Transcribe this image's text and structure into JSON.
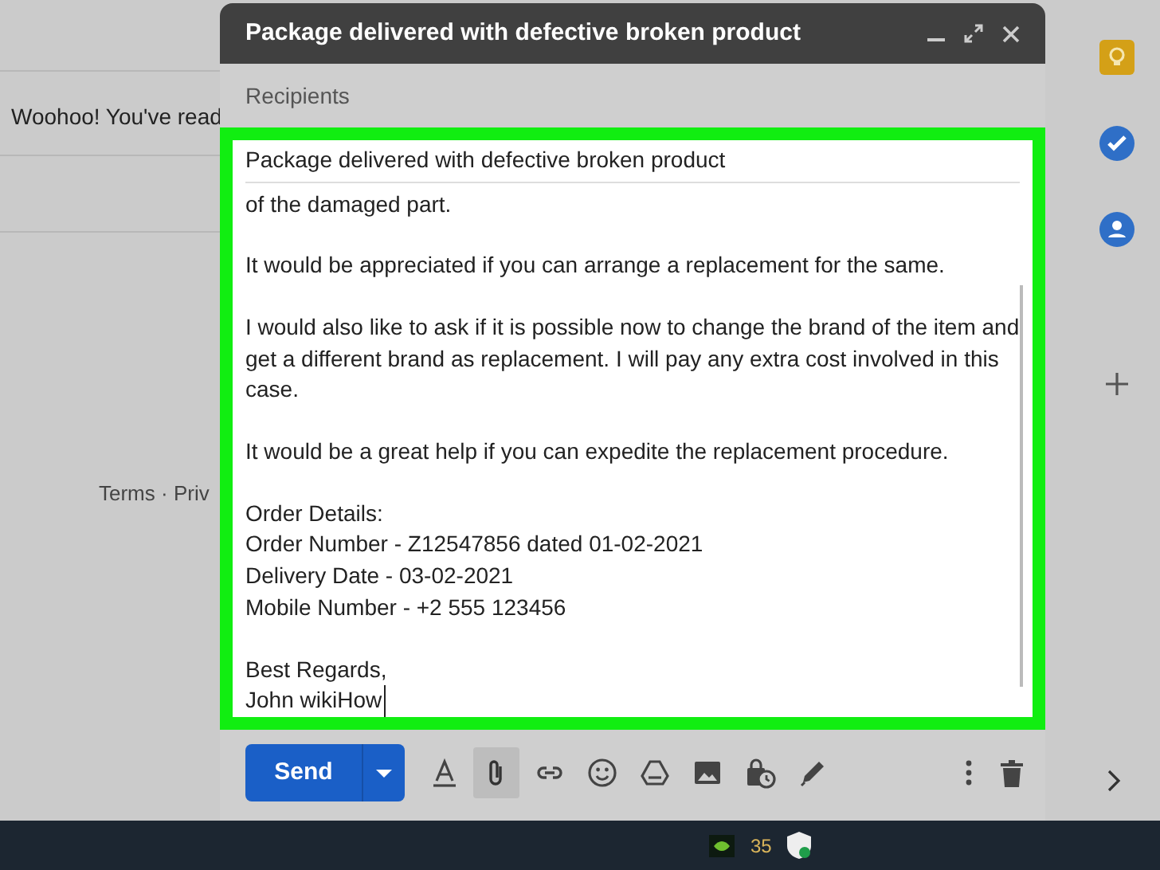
{
  "background": {
    "message": "Woohoo! You've read",
    "footer": "Terms · Priv"
  },
  "compose": {
    "title": "Package delivered with defective broken product",
    "recipients": {
      "placeholder": "Recipients"
    },
    "subject": "Package delivered with defective broken product",
    "body": [
      [
        "of the damaged part."
      ],
      [
        "It would be appreciated if you can arrange a replacement for the same."
      ],
      [
        "I would also like to ask if it is possible now to change the brand of the item and",
        "get a different brand as replacement. I will pay any extra cost involved in this",
        "case."
      ],
      [
        "It would be a great help if you can expedite the replacement procedure."
      ],
      [
        "Order Details:",
        "Order Number - Z12547856 dated 01-02-2021",
        "Delivery Date - 03-02-2021",
        "Mobile Number - +2 555 123456"
      ],
      [
        "Best Regards,",
        "John wikiHow"
      ]
    ],
    "send": "Send",
    "toolbar": [
      {
        "kind": "format",
        "highlighted": false
      },
      {
        "kind": "attach",
        "highlighted": true
      },
      {
        "kind": "link",
        "highlighted": false
      },
      {
        "kind": "emoji",
        "highlighted": false
      },
      {
        "kind": "drive",
        "highlighted": false
      },
      {
        "kind": "photo",
        "highlighted": false
      },
      {
        "kind": "confidential",
        "highlighted": false
      },
      {
        "kind": "signature",
        "highlighted": false
      }
    ]
  },
  "taskbar": {
    "tray_reading": "35"
  }
}
